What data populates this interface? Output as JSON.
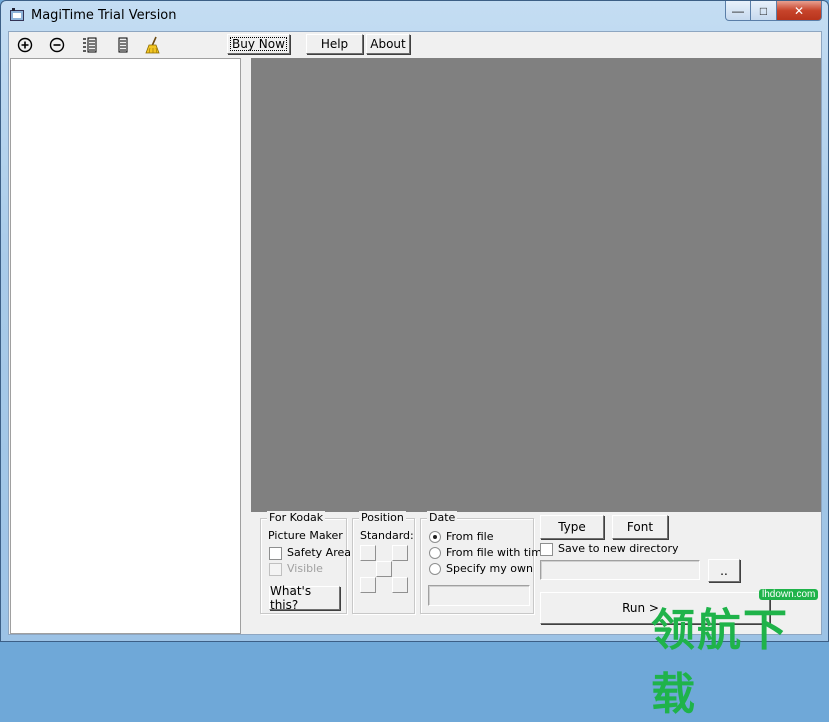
{
  "window": {
    "title": "MagiTime Trial Version"
  },
  "toolbar": {
    "icons": [
      "add-icon",
      "remove-icon",
      "list-icon",
      "columns-icon",
      "broom-icon"
    ],
    "buy_now": "Buy Now",
    "help": "Help",
    "about": "About"
  },
  "kodak": {
    "legend": "For Kodak",
    "subtitle": "Picture Maker",
    "safety_area": "Safety Area",
    "visible": "Visible",
    "whats_this": "What's this?"
  },
  "position": {
    "legend": "Position",
    "standard": "Standard:"
  },
  "date": {
    "legend": "Date",
    "options": [
      "From file",
      "From file with time",
      "Specify my own"
    ],
    "selected": "From file"
  },
  "format": {
    "type_button": "Type",
    "font_button": "Font",
    "save_new_dir": "Save to new directory",
    "browse": "..",
    "run": "Run >"
  },
  "watermark": {
    "text": "领航下载",
    "url": "lhdown.com"
  },
  "colors": {
    "preview_bg": "#808080",
    "watermark_green": "#1fb34a"
  }
}
